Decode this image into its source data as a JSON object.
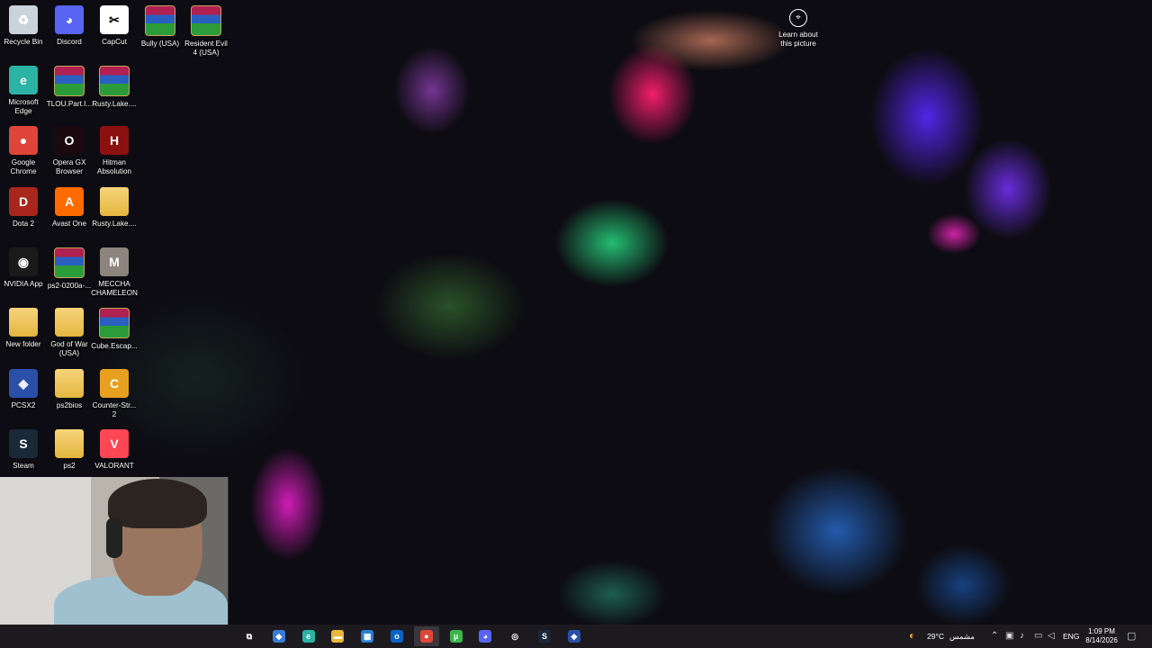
{
  "desktop": {
    "icons": [
      {
        "label": "Recycle Bin",
        "icon": "recycle-bin-icon",
        "color": "#c9d3dc",
        "glyph": "♻"
      },
      {
        "label": "Discord",
        "icon": "discord-icon",
        "color": "#5865f2",
        "glyph": "◕"
      },
      {
        "label": "CapCut",
        "icon": "capcut-icon",
        "color": "#ffffff",
        "glyph": "✂"
      },
      {
        "label": "Bully (USA)",
        "icon": "winrar-icon",
        "color": "winrar",
        "glyph": ""
      },
      {
        "label": "Resident Evil 4 (USA)",
        "icon": "winrar-icon",
        "color": "winrar",
        "glyph": ""
      },
      {
        "label": "Microsoft Edge",
        "icon": "edge-icon",
        "color": "#2bb3a4",
        "glyph": "e"
      },
      {
        "label": "TLOU.Part.I...",
        "icon": "winrar-icon",
        "color": "winrar",
        "glyph": ""
      },
      {
        "label": "Rusty.Lake....",
        "icon": "winrar-icon",
        "color": "winrar",
        "glyph": ""
      },
      {
        "label": "Google Chrome",
        "icon": "chrome-icon",
        "color": "#e0453a",
        "glyph": "●"
      },
      {
        "label": "Opera GX Browser",
        "icon": "opera-gx-icon",
        "color": "#1a0a10",
        "glyph": "O"
      },
      {
        "label": "Hitman Absolution",
        "icon": "hitman-icon",
        "color": "#8c1010",
        "glyph": "H"
      },
      {
        "label": "Dota 2",
        "icon": "dota2-icon",
        "color": "#a8261c",
        "glyph": "D"
      },
      {
        "label": "Avast One",
        "icon": "avast-icon",
        "color": "#ff6b00",
        "glyph": "A"
      },
      {
        "label": "Rusty.Lake....",
        "icon": "folder-icon",
        "color": "folder",
        "glyph": ""
      },
      {
        "label": "NVIDIA App",
        "icon": "nvidia-icon",
        "color": "#1a1a1a",
        "glyph": "◉"
      },
      {
        "label": "ps2-0200a-...",
        "icon": "winrar-icon",
        "color": "winrar",
        "glyph": ""
      },
      {
        "label": "MECCHA CHAMELEON",
        "icon": "meccha-chameleon-icon",
        "color": "#8d857d",
        "glyph": "M"
      },
      {
        "label": "New folder",
        "icon": "folder-icon",
        "color": "folder",
        "glyph": ""
      },
      {
        "label": "God of War (USA)",
        "icon": "folder-icon",
        "color": "folder",
        "glyph": ""
      },
      {
        "label": "Cube.Escap...",
        "icon": "winrar-icon",
        "color": "winrar",
        "glyph": ""
      },
      {
        "label": "PCSX2",
        "icon": "pcsx2-icon",
        "color": "#2a4fa8",
        "glyph": "◈"
      },
      {
        "label": "ps2bios",
        "icon": "folder-icon",
        "color": "folder",
        "glyph": ""
      },
      {
        "label": "Counter-Str... 2",
        "icon": "counter-strike-icon",
        "color": "#e8a020",
        "glyph": "C"
      },
      {
        "label": "Steam",
        "icon": "steam-icon",
        "color": "#1b2838",
        "glyph": "S"
      },
      {
        "label": "ps2",
        "icon": "folder-icon",
        "color": "folder",
        "glyph": ""
      },
      {
        "label": "VALORANT",
        "icon": "valorant-icon",
        "color": "#ff4655",
        "glyph": "V"
      }
    ],
    "learn_about_picture": "Learn about this picture"
  },
  "taskbar": {
    "apps": [
      {
        "name": "task-view-icon",
        "glyph": "⧉",
        "color": "#1c1a1e"
      },
      {
        "name": "copilot-icon",
        "glyph": "◆",
        "color": "#3a7bd5"
      },
      {
        "name": "edge-icon",
        "glyph": "e",
        "color": "#2bb3a4"
      },
      {
        "name": "file-explorer-icon",
        "glyph": "▬",
        "color": "#e9b83b"
      },
      {
        "name": "microsoft-store-icon",
        "glyph": "▦",
        "color": "#2a7fd4"
      },
      {
        "name": "outlook-icon",
        "glyph": "o",
        "color": "#0a64c8"
      },
      {
        "name": "chrome-icon",
        "glyph": "●",
        "color": "#e0453a"
      },
      {
        "name": "utorrent-icon",
        "glyph": "µ",
        "color": "#3ab54a"
      },
      {
        "name": "discord-icon",
        "glyph": "◕",
        "color": "#5865f2"
      },
      {
        "name": "camera-app-icon",
        "glyph": "◎",
        "color": "#1c1a1e"
      },
      {
        "name": "steam-icon",
        "glyph": "S",
        "color": "#1b2838"
      },
      {
        "name": "pcsx2-icon",
        "glyph": "◈",
        "color": "#2a4fa8"
      }
    ],
    "weather": {
      "temp": "29°C",
      "condition": "مشمس"
    },
    "language": "ENG",
    "time": "1:09 PM",
    "date": "8/14/2026"
  }
}
